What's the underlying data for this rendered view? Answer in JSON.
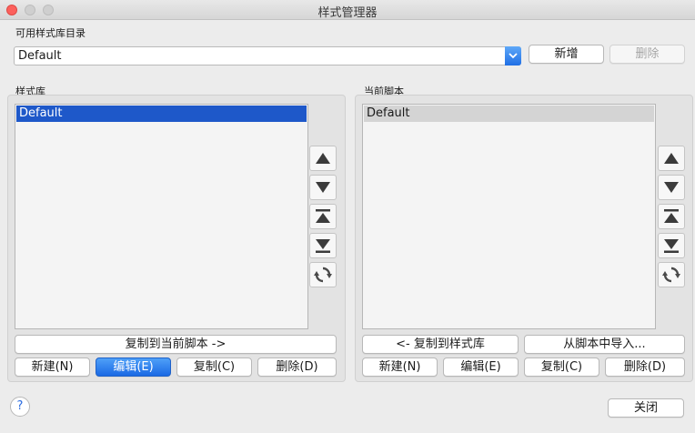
{
  "window": {
    "title": "样式管理器"
  },
  "catalog": {
    "label": "可用样式库目录",
    "selected": "Default",
    "add_label": "新增",
    "delete_label": "删除"
  },
  "library": {
    "label": "样式库",
    "items": [
      "Default"
    ],
    "copy_to_script_label": "复制到当前脚本 ->",
    "new_label": "新建(N)",
    "edit_label": "编辑(E)",
    "copy_label": "复制(C)",
    "delete_label": "删除(D)"
  },
  "script": {
    "label": "当前脚本",
    "items": [
      "Default"
    ],
    "copy_to_library_label": "<- 复制到样式库",
    "import_label": "从脚本中导入...",
    "new_label": "新建(N)",
    "edit_label": "编辑(E)",
    "copy_label": "复制(C)",
    "delete_label": "删除(D)"
  },
  "footer": {
    "help_label": "?",
    "close_label": "关闭"
  },
  "icons": {
    "move_up": "triangle-up-icon",
    "move_down": "triangle-down-icon",
    "move_top": "move-to-top-icon",
    "move_bottom": "move-to-bottom-icon",
    "refresh": "refresh-icon"
  },
  "colors": {
    "selection_blue": "#1e58c9",
    "primary_button": "#1a69e4",
    "close_light": "#fc605c"
  }
}
